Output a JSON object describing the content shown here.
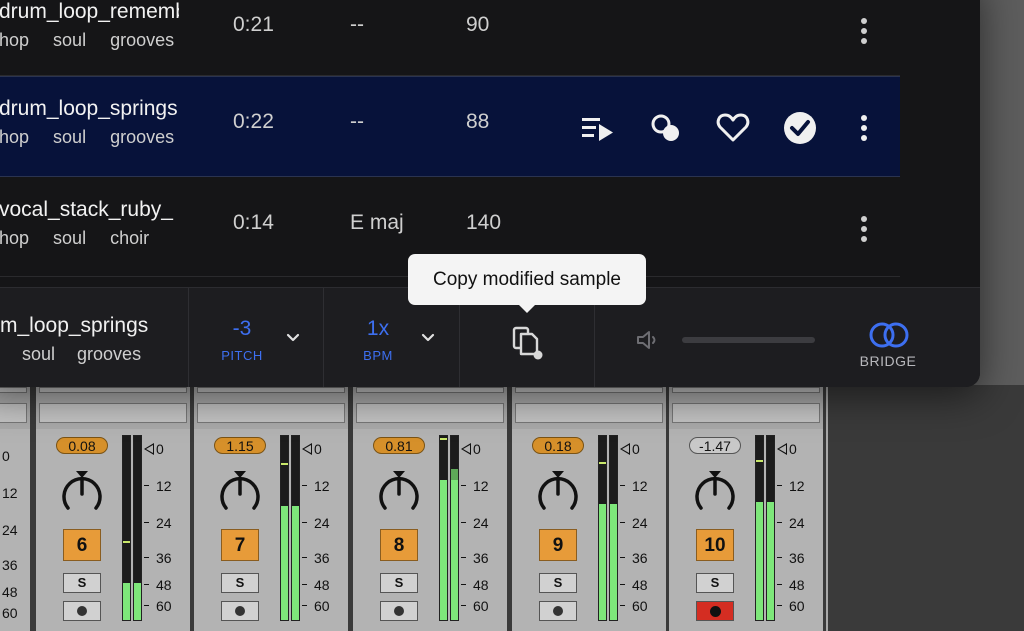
{
  "rows": [
    {
      "name": "drum_loop_rememb",
      "tags": [
        "hop",
        "soul",
        "grooves"
      ],
      "duration": "0:21",
      "key": "--",
      "bpm": "90",
      "selected": false
    },
    {
      "name": "drum_loop_springs",
      "tags": [
        "hop",
        "soul",
        "grooves"
      ],
      "duration": "0:22",
      "key": "--",
      "bpm": "88",
      "selected": true
    },
    {
      "name": "vocal_stack_ruby_",
      "tags": [
        "hop",
        "soul",
        "choir"
      ],
      "duration": "0:14",
      "key": "E maj",
      "bpm": "140",
      "selected": false
    }
  ],
  "row_actions": [
    "queue-play-icon",
    "similar-samples-icon",
    "heart-icon",
    "check-circle-icon",
    "more-vertical-icon"
  ],
  "player": {
    "name": "m_loop_springs",
    "tags": [
      "soul",
      "grooves"
    ],
    "pitch_value": "-3",
    "pitch_label": "PITCH",
    "bpm_value": "1x",
    "bpm_label": "BPM",
    "volume_level": 0.0,
    "bridge_label": "BRIDGE"
  },
  "tooltip": "Copy modified sample",
  "mixer": {
    "scale": [
      "0",
      "12",
      "24",
      "36",
      "48",
      "60"
    ],
    "tracks": [
      {
        "number": "6",
        "volume": "0.08",
        "solo": "S",
        "armed": false
      },
      {
        "number": "7",
        "volume": "1.15",
        "solo": "S",
        "armed": false
      },
      {
        "number": "8",
        "volume": "0.81",
        "solo": "S",
        "armed": false
      },
      {
        "number": "9",
        "volume": "0.18",
        "solo": "S",
        "armed": false
      },
      {
        "number": "10",
        "volume": "-1.47",
        "solo": "S",
        "armed": true
      }
    ]
  },
  "colors": {
    "accent": "#3d6ff0",
    "selected_row": "#07123a",
    "track_orange": "#e79b39",
    "meter_green": "#7ee77a",
    "record_red": "#d42d22"
  }
}
